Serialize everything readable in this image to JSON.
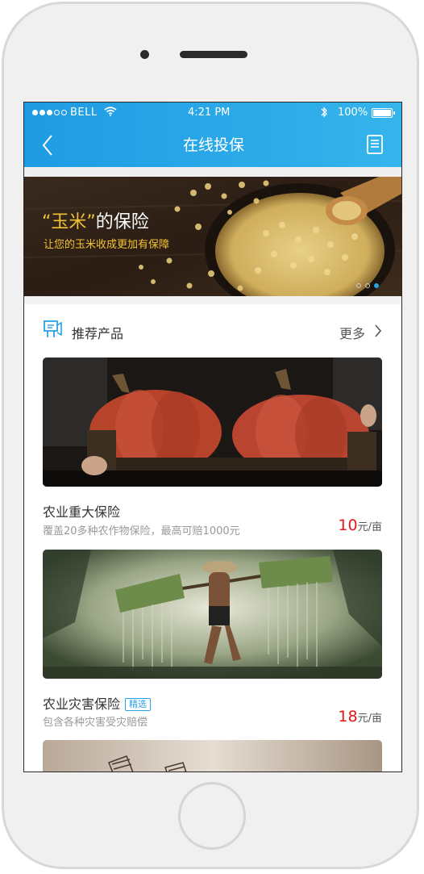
{
  "status": {
    "carrier": "BELL",
    "time": "4:21 PM",
    "battery": "100%"
  },
  "nav": {
    "title": "在线投保"
  },
  "banner": {
    "title_quote": "“玉米”",
    "title_rest": "的保险",
    "subtitle": "让您的玉米收成更加有保障",
    "slide_count": 3,
    "active_slide": 3
  },
  "section": {
    "title": "推荐产品",
    "more": "更多"
  },
  "products": [
    {
      "name": "农业重大保险",
      "tag": "",
      "desc": "覆盖20多种农作物保险，最高可赔1000元",
      "price": "10",
      "unit": "元/亩"
    },
    {
      "name": "农业灾害保险",
      "tag": "精选",
      "desc": "包含各种灾害受灾赔偿",
      "price": "18",
      "unit": "元/亩"
    }
  ],
  "colors": {
    "header_start": "#1f9be3",
    "header_end": "#35b4ec",
    "price_red": "#e5161a",
    "banner_text_gold": "#f2c233"
  }
}
